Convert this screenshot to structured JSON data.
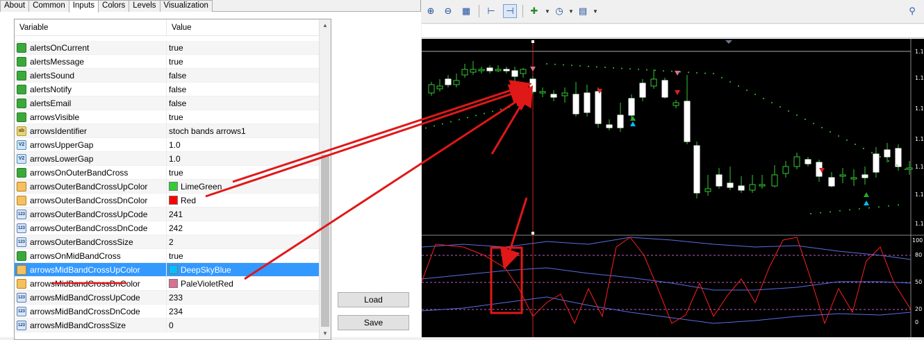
{
  "tabs": [
    "About",
    "Common",
    "Inputs",
    "Colors",
    "Levels",
    "Visualization"
  ],
  "active_tab": "Inputs",
  "grid": {
    "col_variable": "Variable",
    "col_value": "Value",
    "rows": [
      {
        "icon": "bool-icon",
        "variable": "alertsOnCurrent",
        "value": "true"
      },
      {
        "icon": "bool-icon",
        "variable": "alertsMessage",
        "value": "true"
      },
      {
        "icon": "bool-icon",
        "variable": "alertsSound",
        "value": "false"
      },
      {
        "icon": "bool-icon",
        "variable": "alertsNotify",
        "value": "false"
      },
      {
        "icon": "bool-icon",
        "variable": "alertsEmail",
        "value": "false"
      },
      {
        "icon": "bool-icon",
        "variable": "arrowsVisible",
        "value": "true"
      },
      {
        "icon": "string-icon",
        "variable": "arrowsIdentifier",
        "value": "stoch bands arrows1"
      },
      {
        "icon": "double-icon",
        "variable": "arrowsUpperGap",
        "value": "1.0"
      },
      {
        "icon": "double-icon",
        "variable": "arrowsLowerGap",
        "value": "1.0"
      },
      {
        "icon": "bool-icon",
        "variable": "arrowsOnOuterBandCross",
        "value": "true"
      },
      {
        "icon": "color-icon",
        "variable": "arrowsOuterBandCrossUpColor",
        "value": "LimeGreen",
        "swatch": "#32cd32"
      },
      {
        "icon": "color-icon",
        "variable": "arrowsOuterBandCrossDnColor",
        "value": "Red",
        "swatch": "#ff0000"
      },
      {
        "icon": "int-icon",
        "variable": "arrowsOuterBandCrossUpCode",
        "value": "241"
      },
      {
        "icon": "int-icon",
        "variable": "arrowsOuterBandCrossDnCode",
        "value": "242"
      },
      {
        "icon": "int-icon",
        "variable": "arrowsOuterBandCrossSize",
        "value": "2"
      },
      {
        "icon": "bool-icon",
        "variable": "arrowsOnMidBandCross",
        "value": "true"
      },
      {
        "icon": "color-icon",
        "variable": "arrowsMidBandCrossUpColor",
        "value": "DeepSkyBlue",
        "swatch": "#00bfff",
        "selected": true
      },
      {
        "icon": "color-icon",
        "variable": "arrowsMidBandCrossDnColor",
        "value": "PaleVioletRed",
        "swatch": "#db7093"
      },
      {
        "icon": "int-icon",
        "variable": "arrowsMidBandCrossUpCode",
        "value": "233"
      },
      {
        "icon": "int-icon",
        "variable": "arrowsMidBandCrossDnCode",
        "value": "234"
      },
      {
        "icon": "int-icon",
        "variable": "arrowsMidBandCrossSize",
        "value": "0"
      }
    ]
  },
  "buttons": {
    "load": "Load",
    "save": "Save"
  },
  "chart": {
    "price_labels": [
      "1.1",
      "1.1",
      "1.1",
      "1.1",
      "1.1",
      "1.1",
      "1.1"
    ],
    "osc_labels": [
      "100",
      "80",
      "50",
      "20",
      "0"
    ],
    "colors": {
      "background": "#000000",
      "bull": "#ffffff",
      "wick": "#32cd32",
      "band": "#5a6ee6",
      "oscillator": "#ff2020",
      "level": "#c060c0"
    }
  }
}
